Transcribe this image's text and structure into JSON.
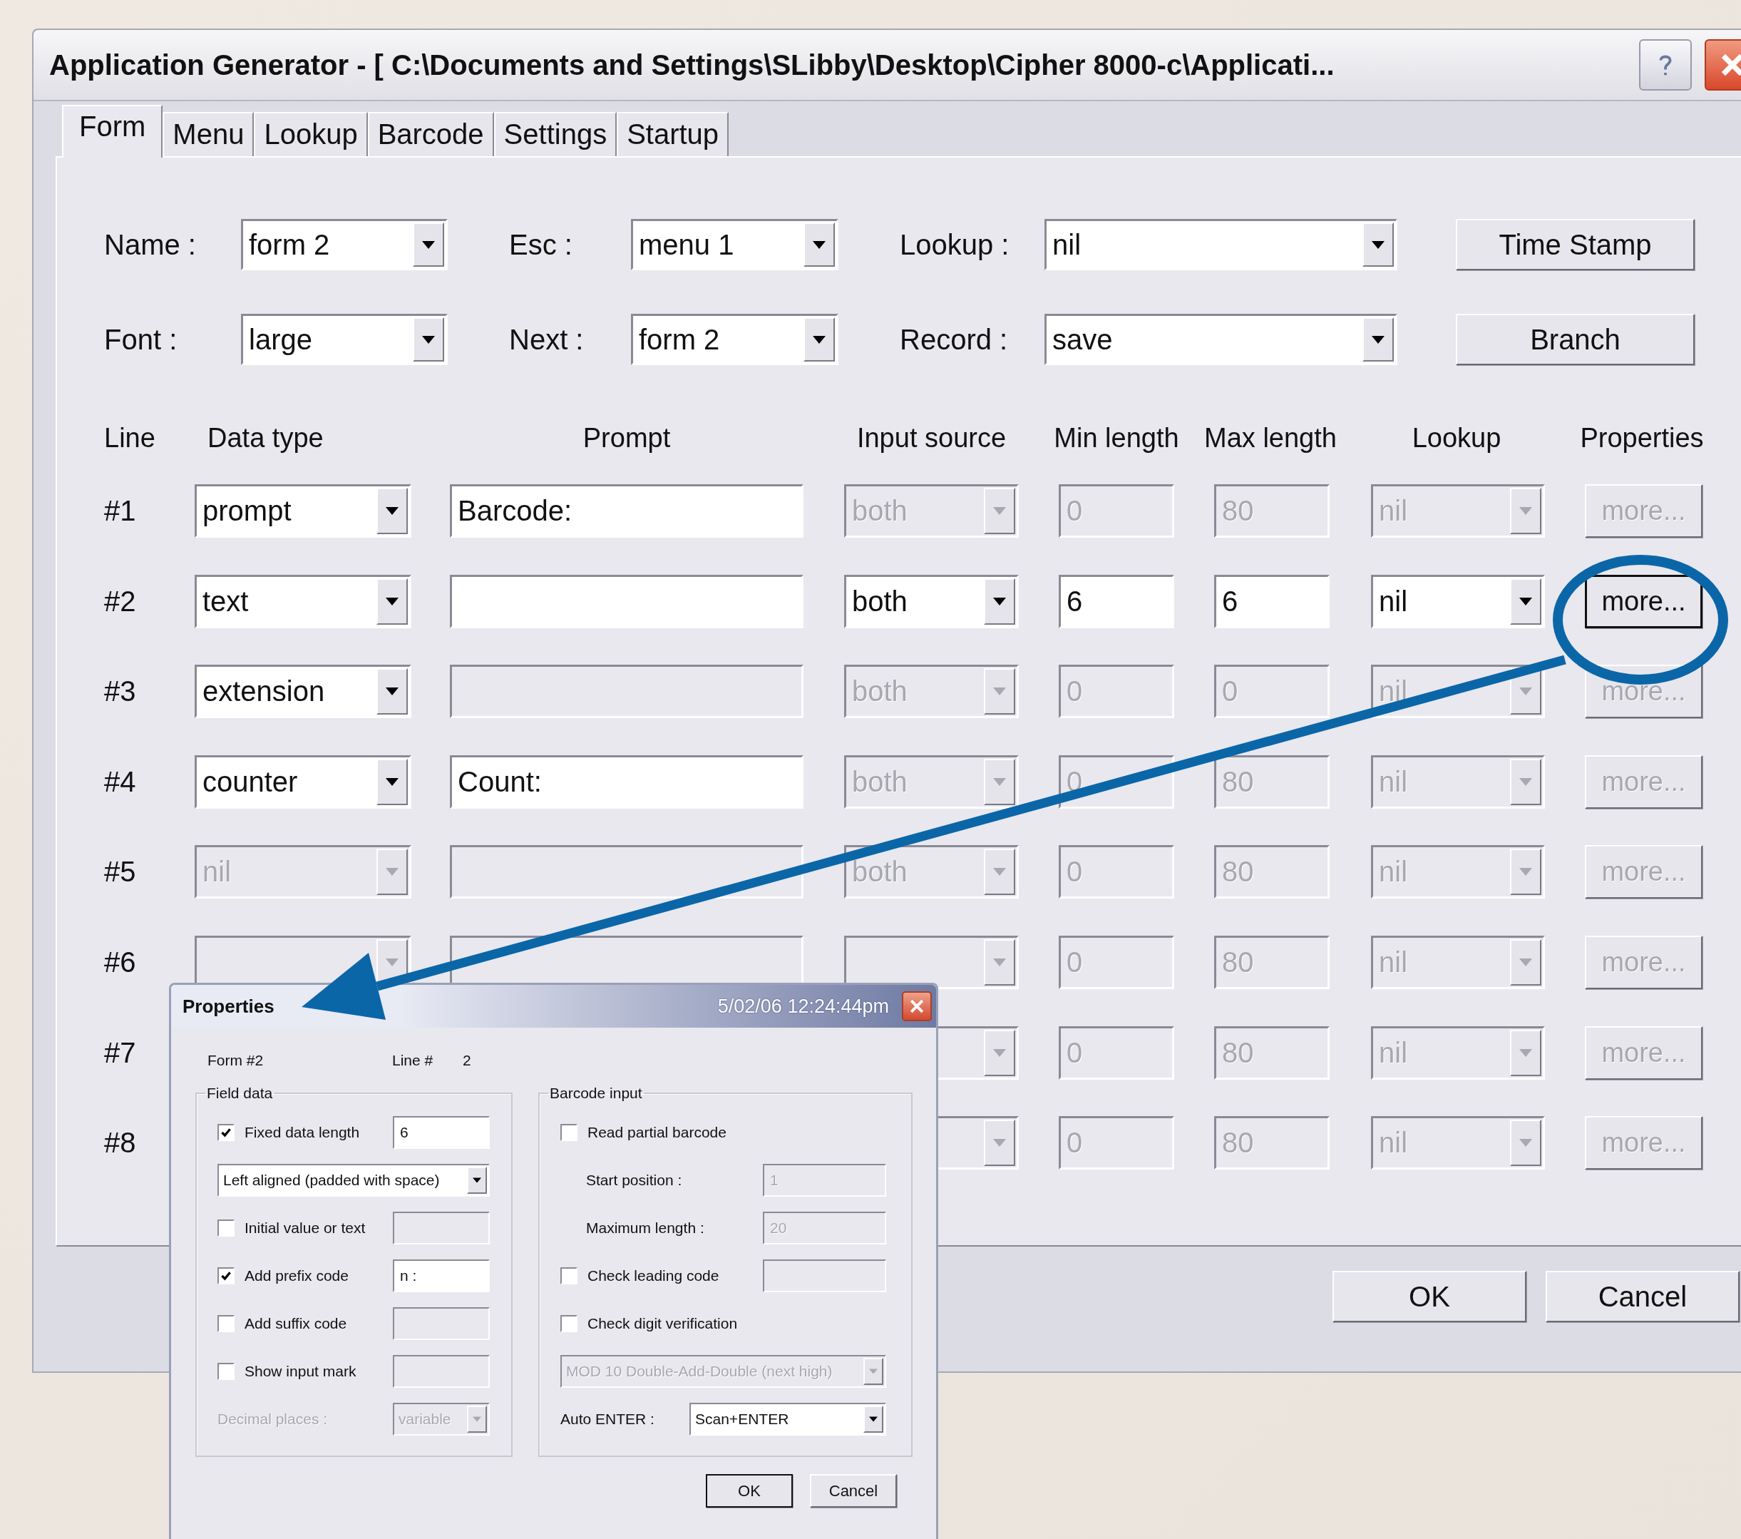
{
  "window": {
    "title": "Application Generator - [ C:\\Documents and Settings\\SLibby\\Desktop\\Cipher 8000-c\\Applicati..."
  },
  "tabs": [
    {
      "label": "Form",
      "selected": true
    },
    {
      "label": "Menu",
      "selected": false
    },
    {
      "label": "Lookup",
      "selected": false
    },
    {
      "label": "Barcode",
      "selected": false
    },
    {
      "label": "Settings",
      "selected": false
    },
    {
      "label": "Startup",
      "selected": false
    }
  ],
  "form_rows": [
    {
      "fields": [
        {
          "label": "Name :",
          "value": "form 2"
        },
        {
          "label": "Esc :",
          "value": "menu 1"
        },
        {
          "label": "Lookup :",
          "value": "nil"
        }
      ],
      "button": "Time Stamp"
    },
    {
      "fields": [
        {
          "label": "Font :",
          "value": "large"
        },
        {
          "label": "Next :",
          "value": "form 2"
        },
        {
          "label": "Record :",
          "value": "save"
        }
      ],
      "button": "Branch"
    }
  ],
  "grid": {
    "columns": [
      "Line",
      "Data type",
      "Prompt",
      "Input source",
      "Min length",
      "Max length",
      "Lookup",
      "Properties"
    ],
    "rows": [
      {
        "line": "#1",
        "data_type": {
          "value": "prompt",
          "disabled": false
        },
        "prompt": {
          "value": "Barcode:",
          "disabled": false
        },
        "input_source": {
          "value": "both",
          "disabled": true
        },
        "min_length": {
          "value": "0",
          "disabled": true
        },
        "max_length": {
          "value": "80",
          "disabled": true
        },
        "lookup": {
          "value": "nil",
          "disabled": true
        },
        "properties": {
          "label": "more...",
          "disabled": true
        }
      },
      {
        "line": "#2",
        "data_type": {
          "value": "text",
          "disabled": false
        },
        "prompt": {
          "disabled": false
        },
        "input_source": {
          "value": "both",
          "disabled": false
        },
        "min_length": {
          "value": "6",
          "disabled": false
        },
        "max_length": {
          "value": "6",
          "disabled": false
        },
        "lookup": {
          "value": "nil",
          "disabled": false
        },
        "properties": {
          "label": "more...",
          "disabled": false
        }
      },
      {
        "line": "#3",
        "data_type": {
          "value": "extension",
          "disabled": false
        },
        "prompt": {
          "disabled": true
        },
        "input_source": {
          "value": "both",
          "disabled": true
        },
        "min_length": {
          "value": "0",
          "disabled": true
        },
        "max_length": {
          "value": "0",
          "disabled": true
        },
        "lookup": {
          "value": "nil",
          "disabled": true
        },
        "properties": {
          "label": "more...",
          "disabled": true
        }
      },
      {
        "line": "#4",
        "data_type": {
          "value": "counter",
          "disabled": false
        },
        "prompt": {
          "value": "Count:",
          "disabled": false
        },
        "input_source": {
          "value": "both",
          "disabled": true
        },
        "min_length": {
          "value": "0",
          "disabled": true
        },
        "max_length": {
          "value": "80",
          "disabled": true
        },
        "lookup": {
          "value": "nil",
          "disabled": true
        },
        "properties": {
          "label": "more...",
          "disabled": true
        }
      },
      {
        "line": "#5",
        "data_type": {
          "value": "nil",
          "disabled": true
        },
        "prompt": {
          "disabled": true
        },
        "input_source": {
          "value": "both",
          "disabled": true
        },
        "min_length": {
          "value": "0",
          "disabled": true
        },
        "max_length": {
          "value": "80",
          "disabled": true
        },
        "lookup": {
          "value": "nil",
          "disabled": true
        },
        "properties": {
          "label": "more...",
          "disabled": true
        }
      },
      {
        "line": "#6",
        "data_type": {
          "disabled": true
        },
        "prompt": {
          "disabled": true
        },
        "input_source": {
          "disabled": true
        },
        "min_length": {
          "value": "0",
          "disabled": true
        },
        "max_length": {
          "value": "80",
          "disabled": true
        },
        "lookup": {
          "value": "nil",
          "disabled": true
        },
        "properties": {
          "label": "more...",
          "disabled": true
        }
      },
      {
        "line": "#7",
        "input_source": {
          "disabled": true
        },
        "min_length": {
          "value": "0",
          "disabled": true
        },
        "max_length": {
          "value": "80",
          "disabled": true
        },
        "lookup": {
          "value": "nil",
          "disabled": true
        },
        "properties": {
          "label": "more...",
          "disabled": true
        }
      },
      {
        "line": "#8",
        "input_source": {
          "disabled": true
        },
        "min_length": {
          "value": "0",
          "disabled": true
        },
        "max_length": {
          "value": "80",
          "disabled": true
        },
        "lookup": {
          "value": "nil",
          "disabled": true
        },
        "properties": {
          "label": "more...",
          "disabled": true
        }
      }
    ]
  },
  "buttons": [
    "OK",
    "Cancel"
  ],
  "properties_dialog": {
    "title": "Properties",
    "timestamp": "5/02/06 12:24:44pm",
    "form_label": "Form #2",
    "line_label": "Line #",
    "line_value": "2",
    "field_data": {
      "title": "Field data",
      "rows": [
        {
          "kind": "checkbox",
          "label": "Fixed data length",
          "checked": true,
          "field": {
            "value": "6",
            "disabled": false
          }
        },
        {
          "kind": "select",
          "select": {
            "value": "Left aligned (padded with space)",
            "disabled": false
          }
        },
        {
          "kind": "checkbox",
          "label": "Initial value or text",
          "checked": false,
          "field": {
            "disabled": true
          }
        },
        {
          "kind": "checkbox",
          "label": "Add prefix code",
          "checked": true,
          "field": {
            "value": "n :",
            "disabled": false
          }
        },
        {
          "kind": "checkbox",
          "label": "Add suffix code",
          "checked": false,
          "field": {
            "disabled": true
          }
        },
        {
          "kind": "checkbox",
          "label": "Show input mark",
          "checked": false,
          "field": {
            "disabled": true
          }
        },
        {
          "kind": "label",
          "label": "Decimal places :",
          "disabled": true,
          "select": {
            "value": "variable",
            "disabled": true
          }
        }
      ]
    },
    "barcode_input": {
      "title": "Barcode input",
      "rows": [
        {
          "kind": "checkbox",
          "label": "Read partial barcode",
          "checked": false
        },
        {
          "kind": "sub_label",
          "label": "Start position :",
          "field": {
            "value": "1",
            "disabled": true
          }
        },
        {
          "kind": "sub_label",
          "label": "Maximum length :",
          "field": {
            "value": "20",
            "disabled": true
          }
        },
        {
          "kind": "checkbox",
          "label": "Check leading code",
          "checked": false,
          "field": {
            "disabled": true
          }
        },
        {
          "kind": "checkbox",
          "label": "Check digit verification",
          "checked": false
        },
        {
          "kind": "select",
          "select": {
            "value": "MOD 10  Double-Add-Double (next high)",
            "disabled": true
          }
        },
        {
          "kind": "label",
          "label": "Auto ENTER :",
          "disabled": false,
          "select": {
            "value": "Scan+ENTER",
            "disabled": false
          }
        }
      ]
    },
    "buttons": [
      "OK",
      "Cancel"
    ]
  }
}
